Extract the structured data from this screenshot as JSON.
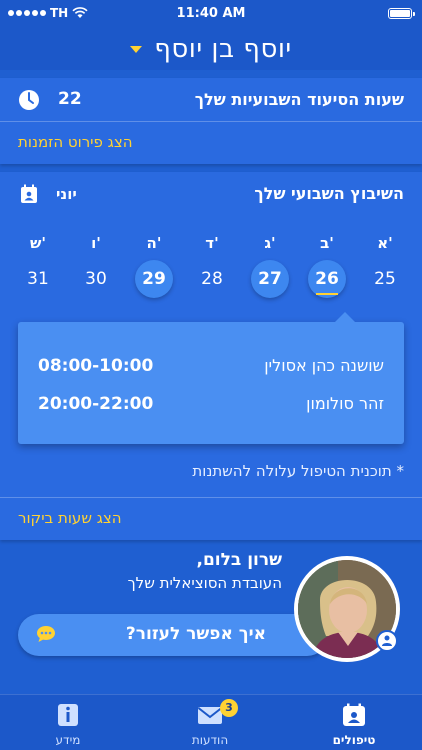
{
  "status_bar": {
    "carrier": "TH",
    "time": "11:40 AM"
  },
  "header": {
    "title": "יוסף בן יוסף"
  },
  "care_hours": {
    "label": "שעות הסיעוד השבועיות שלך",
    "value": "22",
    "availability_link": "הצג פירוט הזמנות"
  },
  "weekly_schedule": {
    "title": "השיבוץ השבועי שלך",
    "month": "יוני",
    "days": [
      {
        "name": "א'",
        "date": "25",
        "has_visit": false,
        "is_today": false
      },
      {
        "name": "ב'",
        "date": "26",
        "has_visit": true,
        "is_today": true
      },
      {
        "name": "ג'",
        "date": "27",
        "has_visit": true,
        "is_today": false
      },
      {
        "name": "ד'",
        "date": "28",
        "has_visit": false,
        "is_today": false
      },
      {
        "name": "ה'",
        "date": "29",
        "has_visit": true,
        "is_today": false
      },
      {
        "name": "ו'",
        "date": "30",
        "has_visit": false,
        "is_today": false
      },
      {
        "name": "ש'",
        "date": "31",
        "has_visit": false,
        "is_today": false
      }
    ],
    "visits": [
      {
        "caregiver": "שושנה כהן אסולין",
        "time": "08:00-10:00"
      },
      {
        "caregiver": "זהר סולומון",
        "time": "20:00-22:00"
      }
    ],
    "note": "* תוכנית הטיפול עלולה להשתנות",
    "visit_hours_link": "הצג שעות ביקור"
  },
  "social_worker": {
    "name": "שרון בלום,",
    "role": "העובדת הסוציאלית שלך",
    "help_button": "איך אפשר לעזור?"
  },
  "tab_bar": {
    "tabs": [
      {
        "label": "מידע",
        "icon": "info-icon",
        "active": false
      },
      {
        "label": "הודעות",
        "icon": "mail-icon",
        "active": false,
        "badge": "3"
      },
      {
        "label": "טיפולים",
        "icon": "calendar-user-icon",
        "active": true
      }
    ]
  },
  "colors": {
    "background": "#1f5fd1",
    "card": "#2a6ae0",
    "accent_yellow": "#ffd233",
    "highlight_blue": "#4a8ff2"
  }
}
